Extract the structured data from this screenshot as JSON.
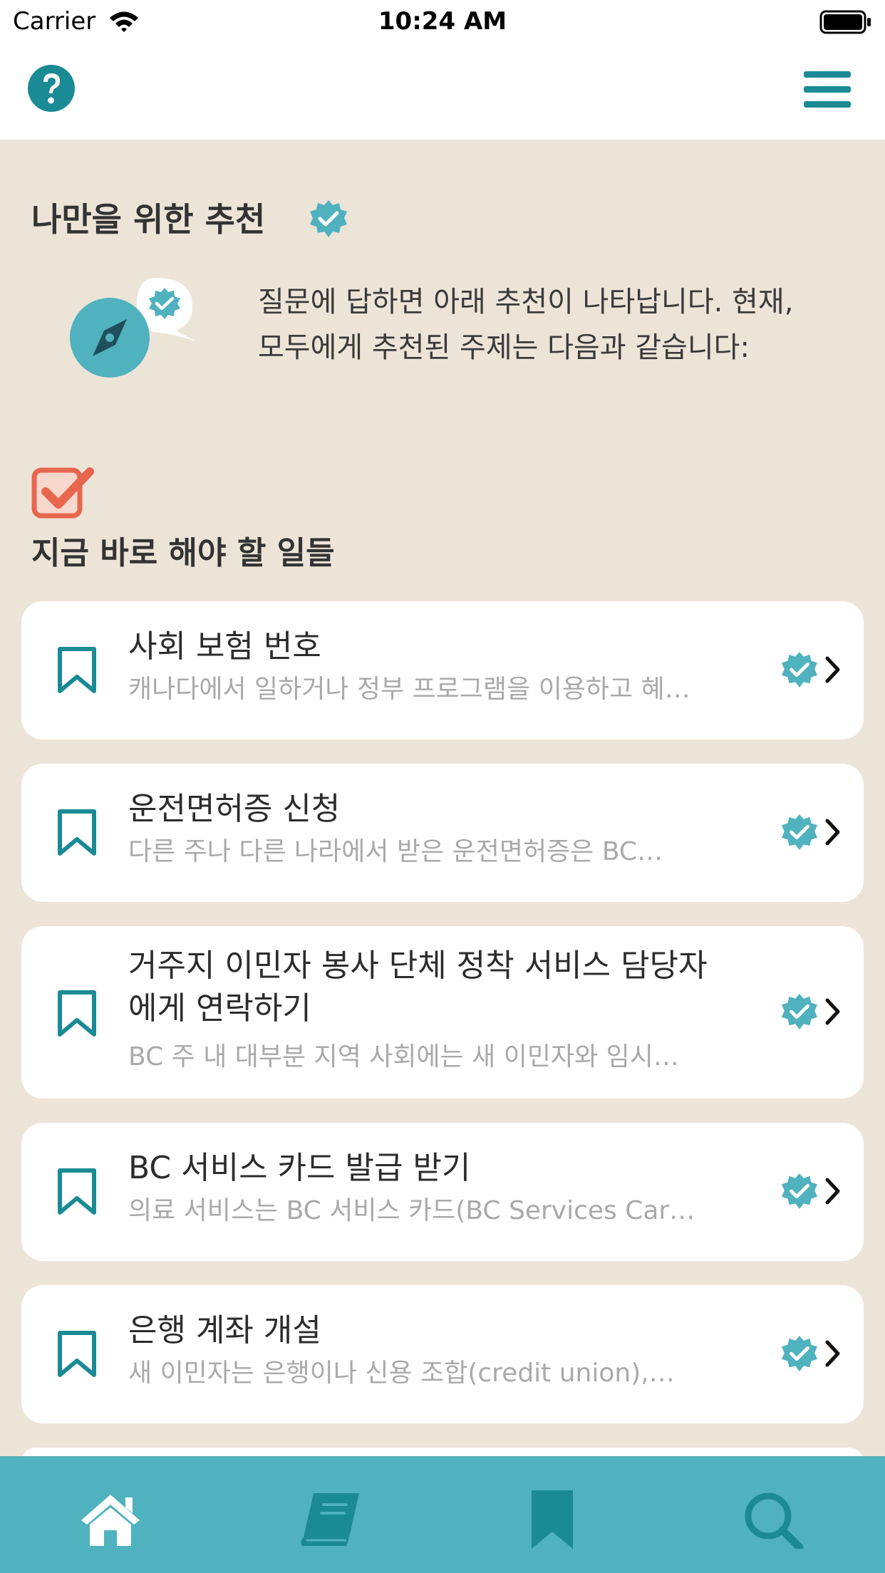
{
  "status_bar": {
    "carrier": "Carrier",
    "time": "10:24 AM"
  },
  "colors": {
    "teal": "#1A8A94",
    "teal_light": "#4FB2BE",
    "background": "#EDE4D8",
    "accent_red": "#E8664E"
  },
  "header": {
    "help_icon": "question-circle-icon",
    "menu_icon": "hamburger-menu-icon"
  },
  "recommendations": {
    "title": "나만을 위한 추천",
    "intro_line1": "질문에 답하면 아래 추천이 나타납니다. 현재,",
    "intro_line2": "모두에게 추천된 주제는 다음과 같습니다:"
  },
  "todo": {
    "title": "지금 바로 해야 할 일들",
    "items": [
      {
        "title": "사회 보험 번호",
        "description": "캐나다에서 일하거나 정부 프로그램을 이용하고 혜…"
      },
      {
        "title": "운전면허증 신청",
        "description": "다른 주나 다른 나라에서 받은 운전면허증은 BC…"
      },
      {
        "title_line1": "거주지 이민자 봉사 단체 정착 서비스 담당자",
        "title_line2": "에게 연락하기",
        "description": "BC 주 내 대부분 지역 사회에는 새 이민자와 임시…"
      },
      {
        "title": "BC 서비스 카드 발급 받기",
        "description": "의료 서비스는 BC 서비스 카드(BC Services Car…"
      },
      {
        "title": "은행 계좌 개설",
        "description": "새 이민자는 은행이나 신용 조합(credit union),…"
      }
    ]
  },
  "tab_bar": {
    "tabs": [
      "home-icon",
      "book-icon",
      "bookmark-icon",
      "search-icon"
    ]
  }
}
